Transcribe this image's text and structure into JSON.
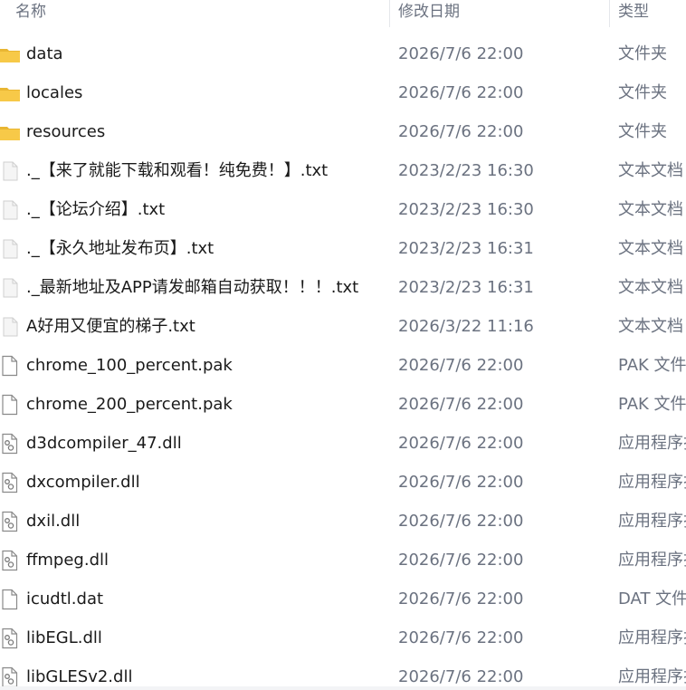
{
  "columns": {
    "name": "名称",
    "modified": "修改日期",
    "type": "类型"
  },
  "files": [
    {
      "name": "data",
      "modified": "2026/7/6 22:00",
      "type": "文件夹",
      "icon": "folder-icon"
    },
    {
      "name": "locales",
      "modified": "2026/7/6 22:00",
      "type": "文件夹",
      "icon": "folder-icon"
    },
    {
      "name": "resources",
      "modified": "2026/7/6 22:00",
      "type": "文件夹",
      "icon": "folder-icon"
    },
    {
      "name": "._【来了就能下载和观看！纯免费！】.txt",
      "modified": "2023/2/23 16:30",
      "type": "文本文档",
      "icon": "text-file-icon"
    },
    {
      "name": "._【论坛介绍】.txt",
      "modified": "2023/2/23 16:30",
      "type": "文本文档",
      "icon": "text-file-icon"
    },
    {
      "name": "._【永久地址发布页】.txt",
      "modified": "2023/2/23 16:31",
      "type": "文本文档",
      "icon": "text-file-icon"
    },
    {
      "name": "._最新地址及APP请发邮箱自动获取！！！.txt",
      "modified": "2023/2/23 16:31",
      "type": "文本文档",
      "icon": "text-file-icon"
    },
    {
      "name": "A好用又便宜的梯子.txt",
      "modified": "2026/3/22 11:16",
      "type": "文本文档",
      "icon": "text-file-icon"
    },
    {
      "name": "chrome_100_percent.pak",
      "modified": "2026/7/6 22:00",
      "type": "PAK 文件",
      "icon": "file-icon"
    },
    {
      "name": "chrome_200_percent.pak",
      "modified": "2026/7/6 22:00",
      "type": "PAK 文件",
      "icon": "file-icon"
    },
    {
      "name": "d3dcompiler_47.dll",
      "modified": "2026/7/6 22:00",
      "type": "应用程序扩展",
      "icon": "dll-file-icon"
    },
    {
      "name": "dxcompiler.dll",
      "modified": "2026/7/6 22:00",
      "type": "应用程序扩展",
      "icon": "dll-file-icon"
    },
    {
      "name": "dxil.dll",
      "modified": "2026/7/6 22:00",
      "type": "应用程序扩展",
      "icon": "dll-file-icon"
    },
    {
      "name": "ffmpeg.dll",
      "modified": "2026/7/6 22:00",
      "type": "应用程序扩展",
      "icon": "dll-file-icon"
    },
    {
      "name": "icudtl.dat",
      "modified": "2026/7/6 22:00",
      "type": "DAT 文件",
      "icon": "file-icon"
    },
    {
      "name": "libEGL.dll",
      "modified": "2026/7/6 22:00",
      "type": "应用程序扩展",
      "icon": "dll-file-icon"
    },
    {
      "name": "libGLESv2.dll",
      "modified": "2026/7/6 22:00",
      "type": "应用程序扩展",
      "icon": "dll-file-icon"
    }
  ],
  "colors": {
    "folder": "#f7c948",
    "folder_dark": "#e9b632",
    "text_primary": "#1a1a1a",
    "text_secondary": "#6b7280"
  }
}
